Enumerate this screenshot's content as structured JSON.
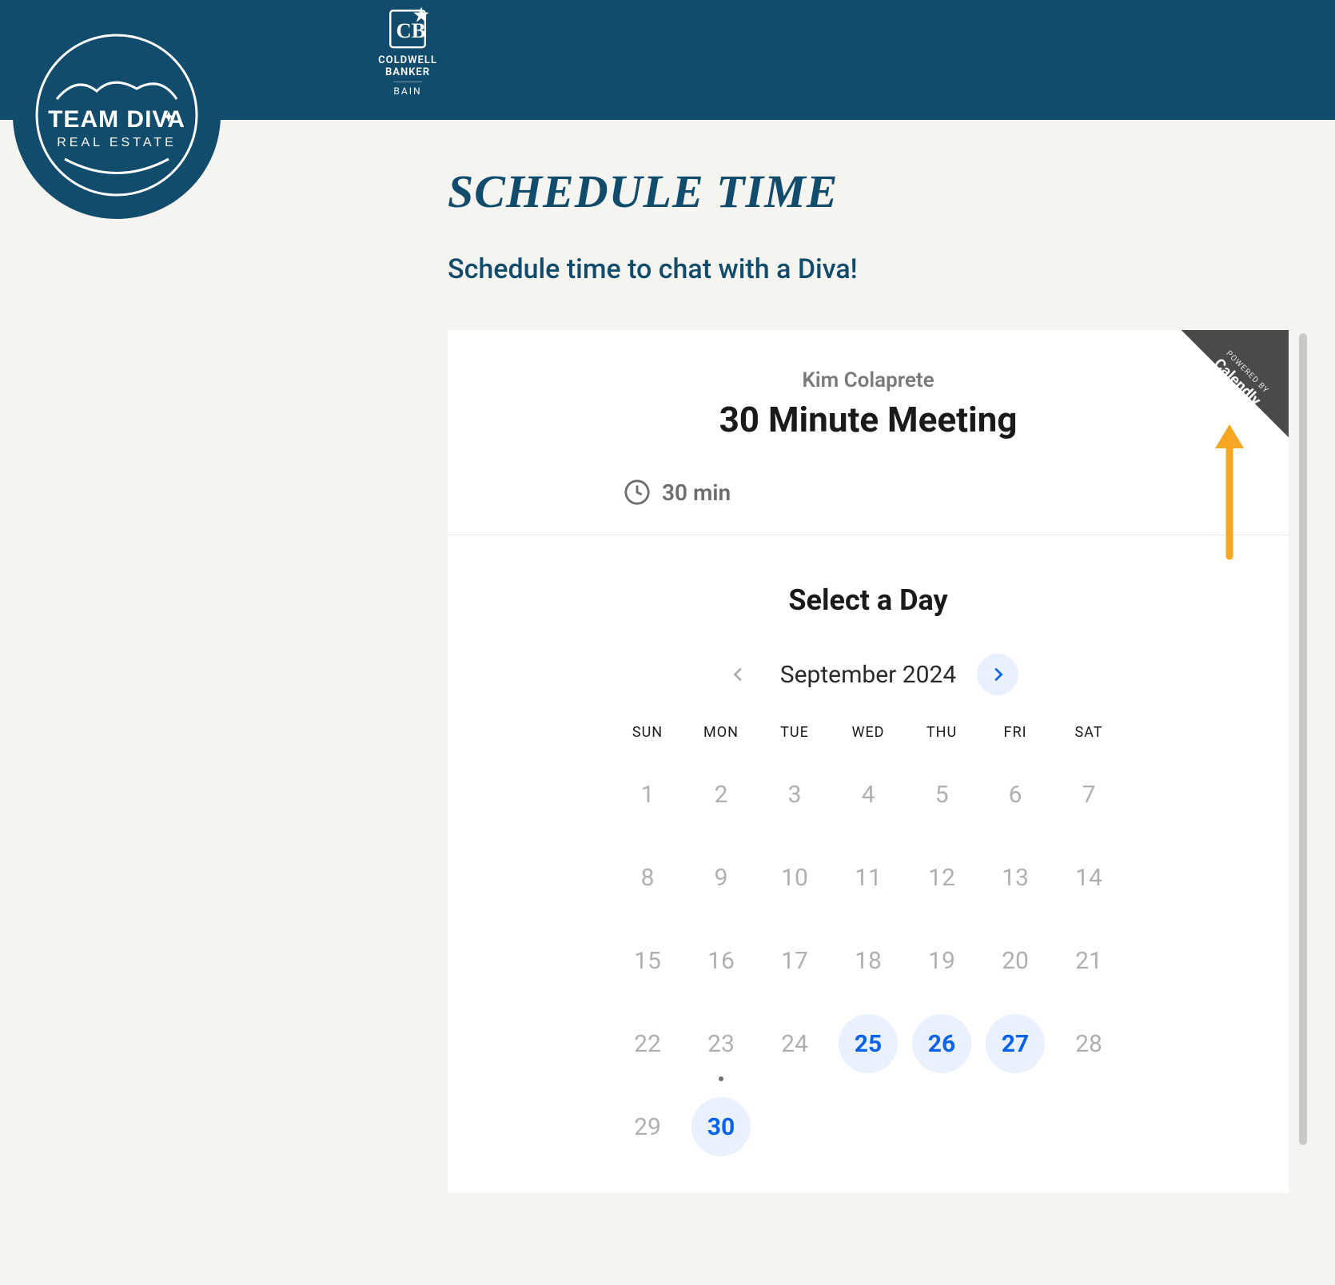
{
  "brand": {
    "team_diva_line1": "TEAM DIVA",
    "team_diva_line2": "REAL ESTATE",
    "cb_line1": "COLDWELL",
    "cb_line2": "BANKER",
    "cb_line3": "BAIN"
  },
  "page": {
    "heading": "SCHEDULE TIME",
    "subheading": "Schedule time to chat with a Diva!"
  },
  "calendly": {
    "powered_by_label": "POWERED BY",
    "brand": "Calendly",
    "host_name": "Kim Colaprete",
    "meeting_title": "30 Minute Meeting",
    "duration_label": "30 min",
    "select_day_title": "Select a Day",
    "month_label": "September 2024",
    "dow": [
      "SUN",
      "MON",
      "TUE",
      "WED",
      "THU",
      "FRI",
      "SAT"
    ],
    "days": [
      {
        "n": "1",
        "available": false,
        "today": false
      },
      {
        "n": "2",
        "available": false,
        "today": false
      },
      {
        "n": "3",
        "available": false,
        "today": false
      },
      {
        "n": "4",
        "available": false,
        "today": false
      },
      {
        "n": "5",
        "available": false,
        "today": false
      },
      {
        "n": "6",
        "available": false,
        "today": false
      },
      {
        "n": "7",
        "available": false,
        "today": false
      },
      {
        "n": "8",
        "available": false,
        "today": false
      },
      {
        "n": "9",
        "available": false,
        "today": false
      },
      {
        "n": "10",
        "available": false,
        "today": false
      },
      {
        "n": "11",
        "available": false,
        "today": false
      },
      {
        "n": "12",
        "available": false,
        "today": false
      },
      {
        "n": "13",
        "available": false,
        "today": false
      },
      {
        "n": "14",
        "available": false,
        "today": false
      },
      {
        "n": "15",
        "available": false,
        "today": false
      },
      {
        "n": "16",
        "available": false,
        "today": false
      },
      {
        "n": "17",
        "available": false,
        "today": false
      },
      {
        "n": "18",
        "available": false,
        "today": false
      },
      {
        "n": "19",
        "available": false,
        "today": false
      },
      {
        "n": "20",
        "available": false,
        "today": false
      },
      {
        "n": "21",
        "available": false,
        "today": false
      },
      {
        "n": "22",
        "available": false,
        "today": false
      },
      {
        "n": "23",
        "available": false,
        "today": true
      },
      {
        "n": "24",
        "available": false,
        "today": false
      },
      {
        "n": "25",
        "available": true,
        "today": false
      },
      {
        "n": "26",
        "available": true,
        "today": false
      },
      {
        "n": "27",
        "available": true,
        "today": false
      },
      {
        "n": "28",
        "available": false,
        "today": false
      },
      {
        "n": "29",
        "available": false,
        "today": false
      },
      {
        "n": "30",
        "available": true,
        "today": false
      }
    ]
  }
}
